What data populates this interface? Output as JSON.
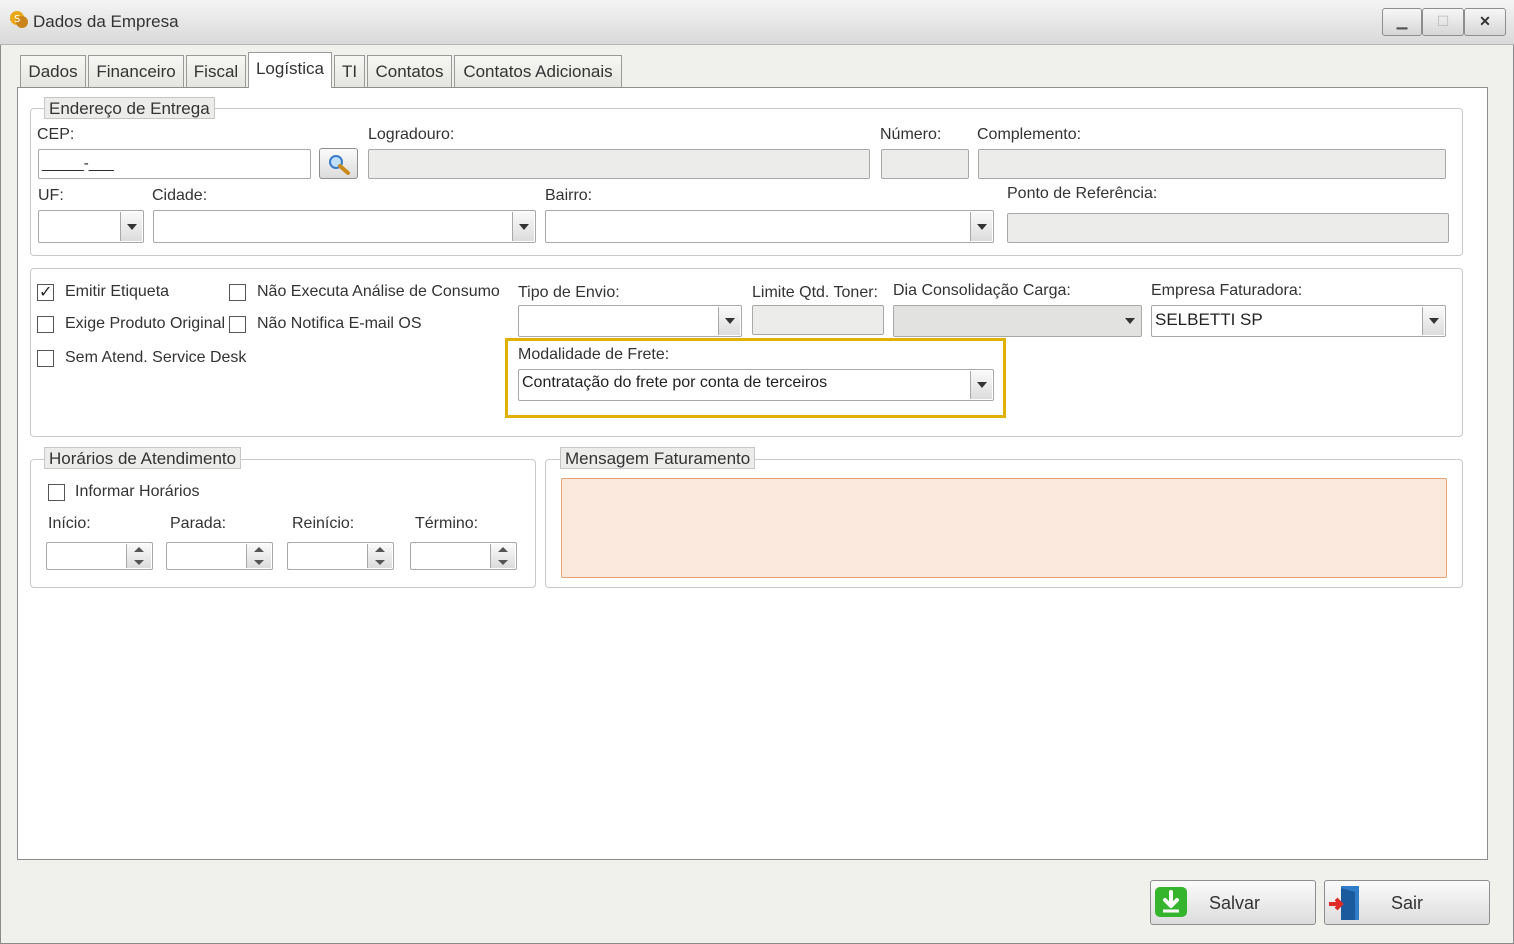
{
  "window": {
    "title": "Dados da Empresa",
    "minimize_glyph": "▁",
    "maximize_glyph": "☐",
    "close_glyph": "✕"
  },
  "tabs": [
    {
      "label": "Dados"
    },
    {
      "label": "Financeiro"
    },
    {
      "label": "Fiscal"
    },
    {
      "label": "Logística",
      "active": true
    },
    {
      "label": "TI"
    },
    {
      "label": "Contatos"
    },
    {
      "label": "Contatos Adicionais"
    }
  ],
  "endereco": {
    "legend": "Endereço de Entrega",
    "cep_label": "CEP:",
    "cep_value": "_____-___",
    "logradouro_label": "Logradouro:",
    "numero_label": "Número:",
    "complemento_label": "Complemento:",
    "uf_label": "UF:",
    "cidade_label": "Cidade:",
    "bairro_label": "Bairro:",
    "ponto_label": "Ponto de Referência:"
  },
  "options": {
    "emitir_etiqueta": {
      "label": "Emitir Etiqueta",
      "checked": true
    },
    "nao_executa": {
      "label": "Não Executa Análise de Consumo",
      "checked": false
    },
    "exige_produto": {
      "label": "Exige Produto Original",
      "checked": false
    },
    "nao_notifica": {
      "label": "Não Notifica E-mail OS",
      "checked": false
    },
    "sem_atend": {
      "label": "Sem Atend. Service Desk",
      "checked": false
    },
    "tipo_envio_label": "Tipo de Envio:",
    "limite_toner_label": "Limite Qtd. Toner:",
    "dia_consolidacao_label": "Dia Consolidação Carga:",
    "empresa_faturadora_label": "Empresa Faturadora:",
    "empresa_faturadora_value": "SELBETTI SP",
    "modalidade_label": "Modalidade de Frete:",
    "modalidade_value": "Contratação do frete por conta de terceiros"
  },
  "horarios": {
    "legend": "Horários de Atendimento",
    "informar_label": "Informar Horários",
    "inicio_label": "Início:",
    "parada_label": "Parada:",
    "reinicio_label": "Reinício:",
    "termino_label": "Término:"
  },
  "mensagem": {
    "legend": "Mensagem Faturamento"
  },
  "buttons": {
    "salvar": "Salvar",
    "sair": "Sair"
  },
  "colors": {
    "highlight": "#e0b100",
    "mensagem_border": "#e8a070",
    "mensagem_bg": "#fbe9de"
  }
}
